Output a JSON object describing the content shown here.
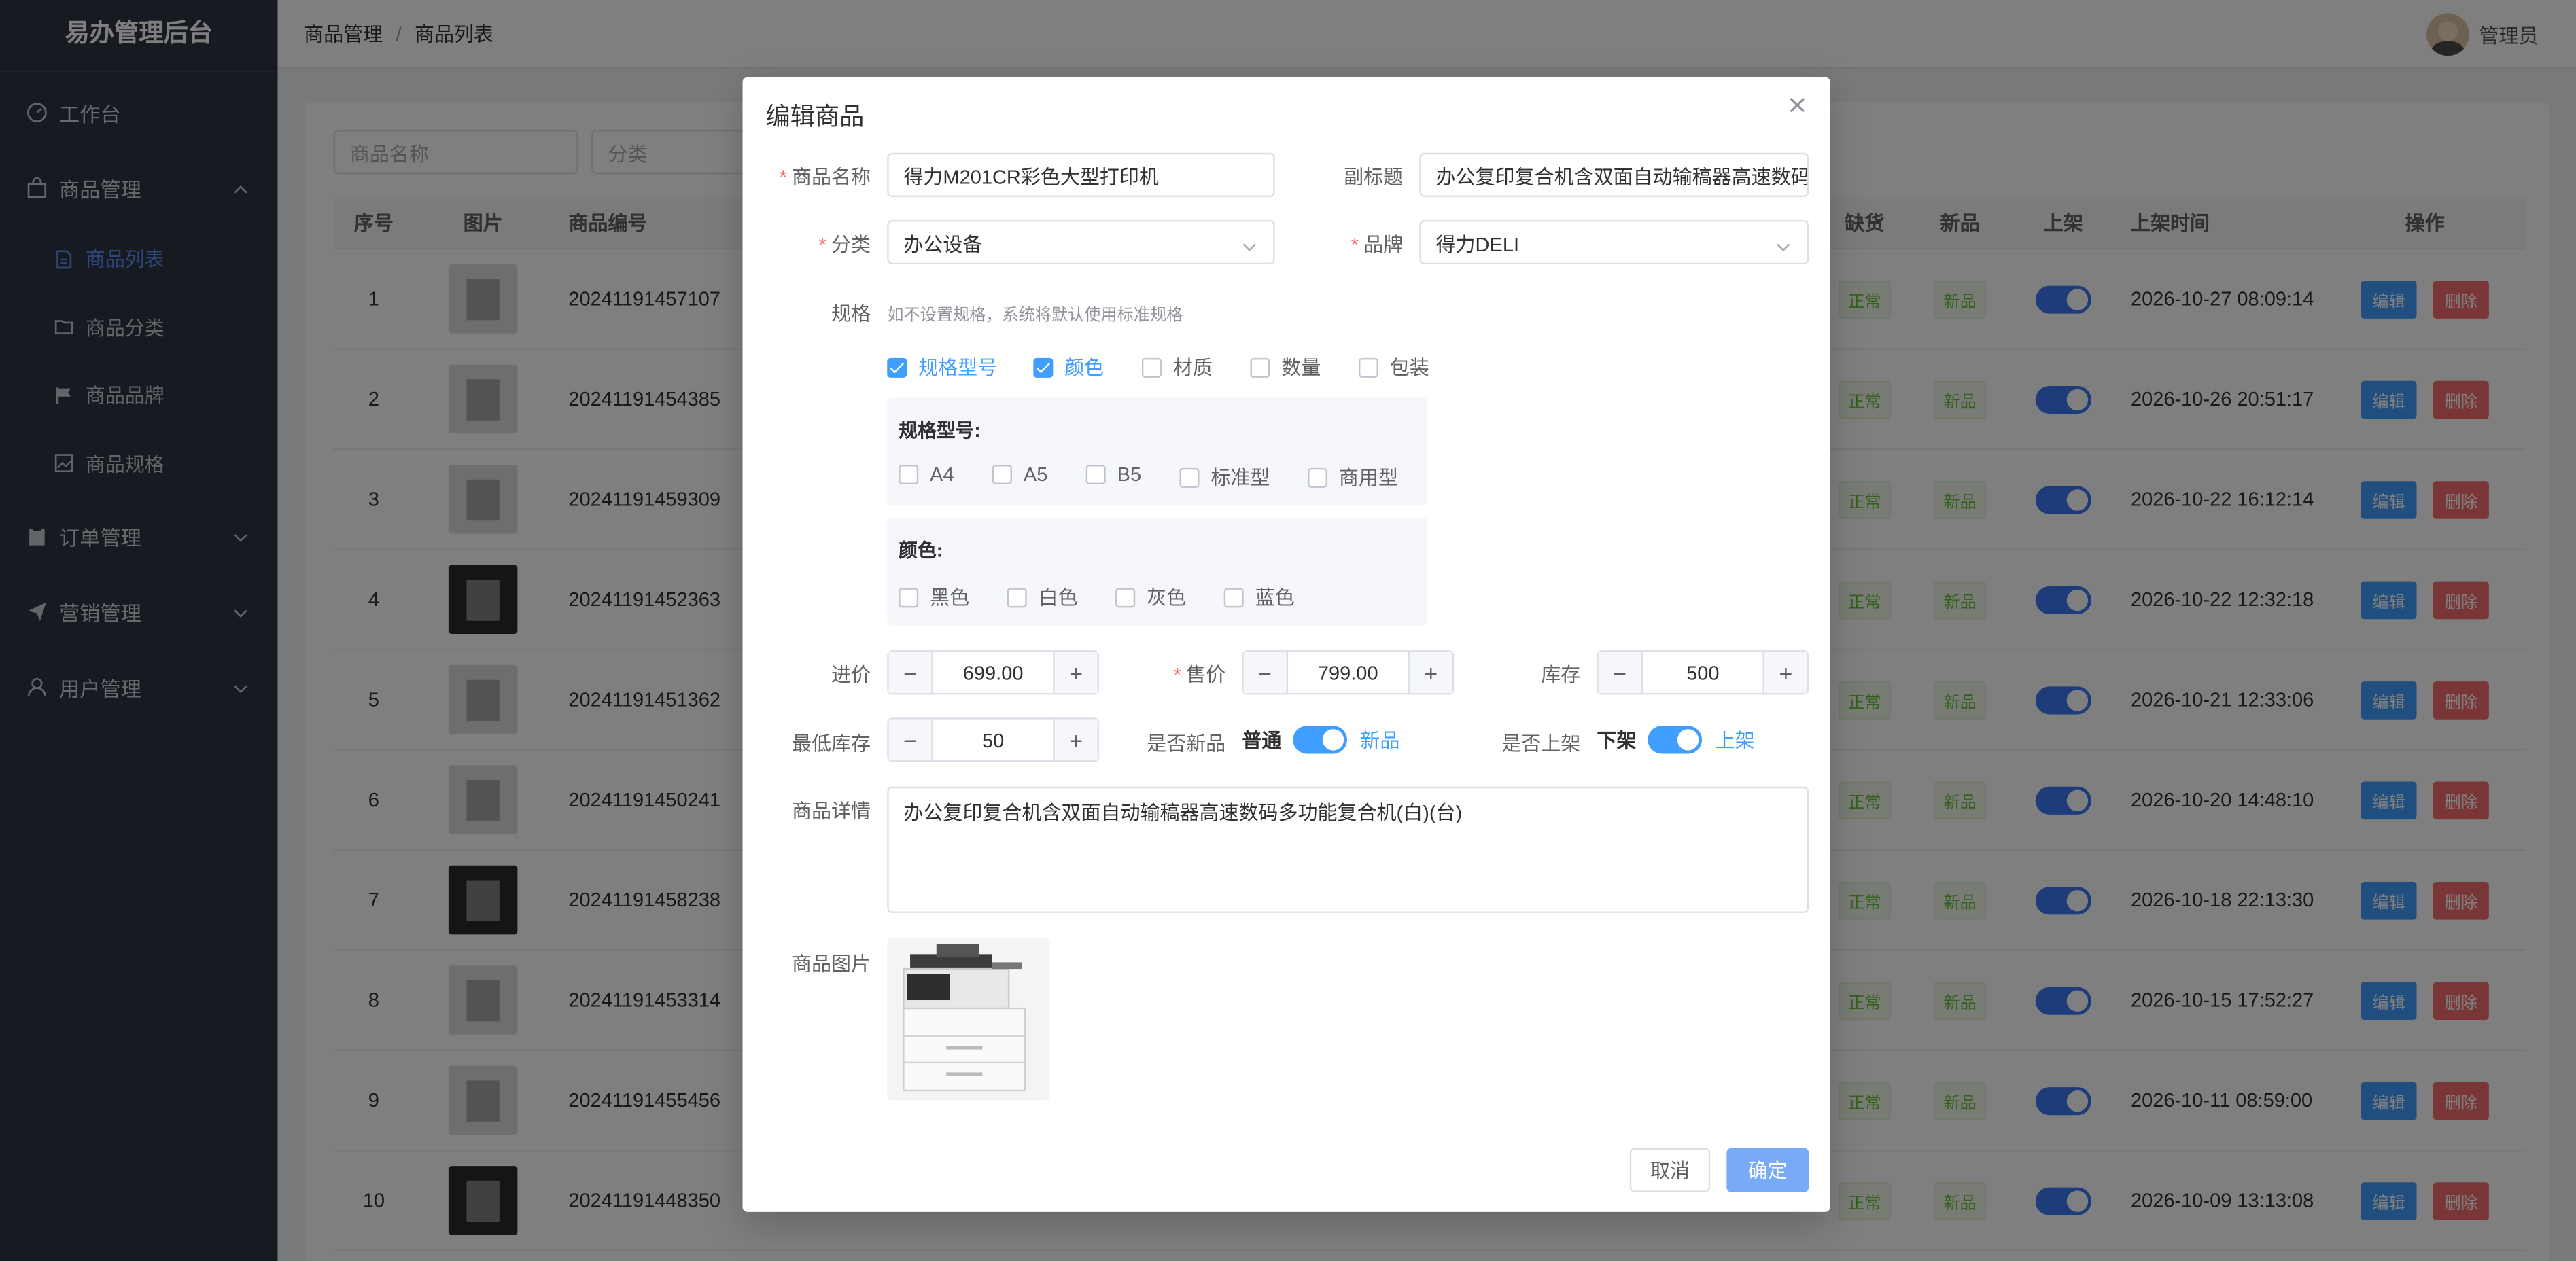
{
  "sidebar": {
    "brand": "易办管理后台",
    "workbench": "工作台",
    "goods": "商品管理",
    "goods_items": [
      "商品列表",
      "商品分类",
      "商品品牌",
      "商品规格"
    ],
    "orders": "订单管理",
    "marketing": "营销管理",
    "users": "用户管理"
  },
  "header": {
    "crumb1": "商品管理",
    "crumb2": "商品列表",
    "user": "管理员"
  },
  "filters": {
    "name_placeholder": "商品名称",
    "category_placeholder": "分类"
  },
  "table": {
    "headers": {
      "idx": "序号",
      "img": "图片",
      "code": "商品编号",
      "stock": "缺货",
      "new": "新品",
      "up": "上架",
      "time": "上架时间",
      "op": "操作"
    },
    "stock_label": "正常",
    "new_label": "新品",
    "edit_label": "编辑",
    "delete_label": "删除",
    "rows": [
      {
        "idx": "1",
        "code": "20241191457107",
        "time": "2026-10-27 08:09:14"
      },
      {
        "idx": "2",
        "code": "20241191454385",
        "time": "2026-10-26 20:51:17"
      },
      {
        "idx": "3",
        "code": "20241191459309",
        "time": "2026-10-22 16:12:14"
      },
      {
        "idx": "4",
        "code": "20241191452363",
        "time": "2026-10-22 12:32:18"
      },
      {
        "idx": "5",
        "code": "20241191451362",
        "time": "2026-10-21 12:33:06"
      },
      {
        "idx": "6",
        "code": "20241191450241",
        "time": "2026-10-20 14:48:10"
      },
      {
        "idx": "7",
        "code": "20241191458238",
        "time": "2026-10-18 22:13:30"
      },
      {
        "idx": "8",
        "code": "20241191453314",
        "time": "2026-10-15 17:52:27"
      },
      {
        "idx": "9",
        "code": "20241191455456",
        "time": "2026-10-11 08:59:00"
      },
      {
        "idx": "10",
        "code": "20241191448350",
        "time": "2026-10-09 13:13:08"
      }
    ]
  },
  "dialog": {
    "title": "编辑商品",
    "name_label": "商品名称",
    "name_value": "得力M201CR彩色大型打印机",
    "subtitle_label": "副标题",
    "subtitle_value": "办公复印复合机含双面自动输稿器高速数码",
    "category_label": "分类",
    "category_value": "办公设备",
    "brand_label": "品牌",
    "brand_value": "得力DELI",
    "spec_label": "规格",
    "spec_hint": "如不设置规格，系统将默认使用标准规格",
    "spec_types": [
      {
        "label": "规格型号",
        "checked": true
      },
      {
        "label": "颜色",
        "checked": true
      },
      {
        "label": "材质",
        "checked": false
      },
      {
        "label": "数量",
        "checked": false
      },
      {
        "label": "包装",
        "checked": false
      }
    ],
    "model_title": "规格型号:",
    "model_options": [
      "A4",
      "A5",
      "B5",
      "标准型",
      "商用型"
    ],
    "color_title": "颜色:",
    "color_options": [
      "黑色",
      "白色",
      "灰色",
      "蓝色"
    ],
    "cost_label": "进价",
    "cost_value": "699.00",
    "price_label": "售价",
    "price_value": "799.00",
    "stock_label": "库存",
    "stock_value": "500",
    "min_stock_label": "最低库存",
    "min_stock_value": "50",
    "is_new_label": "是否新品",
    "is_new_off": "普通",
    "is_new_on": "新品",
    "is_up_label": "是否上架",
    "is_up_off": "下架",
    "is_up_on": "上架",
    "detail_label": "商品详情",
    "detail_value": "办公复印复合机含双面自动输稿器高速数码多功能复合机(白)(台)",
    "image_label": "商品图片",
    "cancel": "取消",
    "confirm": "确定",
    "minus": "−",
    "plus": "+"
  }
}
